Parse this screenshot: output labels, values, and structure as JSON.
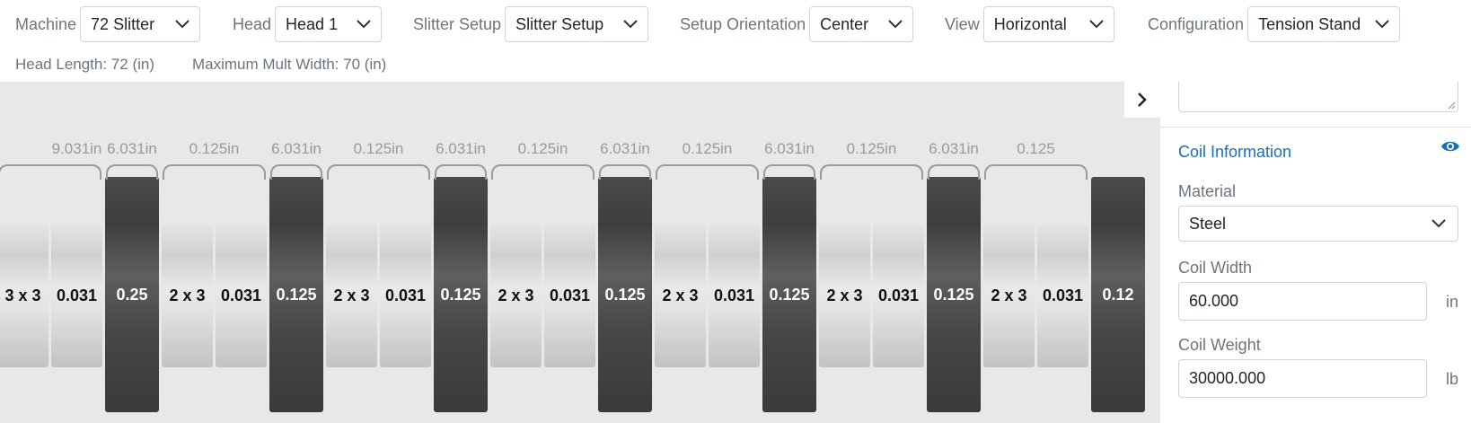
{
  "toolbar": {
    "machine": {
      "label": "Machine",
      "value": "72 Slitter"
    },
    "head": {
      "label": "Head",
      "value": "Head 1"
    },
    "slitter_setup": {
      "label": "Slitter Setup",
      "value": "Slitter Setup"
    },
    "setup_orientation": {
      "label": "Setup Orientation",
      "value": "Center"
    },
    "view": {
      "label": "View",
      "value": "Horizontal"
    },
    "configuration": {
      "label": "Configuration",
      "value": "Tension Stand"
    }
  },
  "info": {
    "head_length": "Head Length: 72 (in)",
    "max_mult_width": "Maximum Mult Width: 70 (in)"
  },
  "layout": {
    "dimension_labels": [
      "9.031in",
      "6.031in",
      "0.125in",
      "6.031in",
      "0.125in",
      "6.031in",
      "0.125in",
      "6.031in",
      "0.125in",
      "6.031in",
      "0.125in",
      "6.031in",
      "0.125"
    ],
    "tools": [
      {
        "type": "spacer",
        "label": "3 x 3"
      },
      {
        "type": "spacer",
        "label": "0.031"
      },
      {
        "type": "knife",
        "label": "0.25"
      },
      {
        "type": "spacer",
        "label": "2 x 3"
      },
      {
        "type": "spacer",
        "label": "0.031"
      },
      {
        "type": "knife",
        "label": "0.125"
      },
      {
        "type": "spacer",
        "label": "2 x 3"
      },
      {
        "type": "spacer",
        "label": "0.031"
      },
      {
        "type": "knife",
        "label": "0.125"
      },
      {
        "type": "spacer",
        "label": "2 x 3"
      },
      {
        "type": "spacer",
        "label": "0.031"
      },
      {
        "type": "knife",
        "label": "0.125"
      },
      {
        "type": "spacer",
        "label": "2 x 3"
      },
      {
        "type": "spacer",
        "label": "0.031"
      },
      {
        "type": "knife",
        "label": "0.125"
      },
      {
        "type": "spacer",
        "label": "2 x 3"
      },
      {
        "type": "spacer",
        "label": "0.031"
      },
      {
        "type": "knife",
        "label": "0.125"
      },
      {
        "type": "spacer",
        "label": "2 x 3"
      },
      {
        "type": "spacer",
        "label": "0.031"
      },
      {
        "type": "knife",
        "label": "0.12"
      }
    ]
  },
  "panel": {
    "toggle_icon": "chevron-right-icon",
    "section_title": "Coil Information",
    "visibility_icon": "eye-icon",
    "material": {
      "label": "Material",
      "value": "Steel"
    },
    "coil_width": {
      "label": "Coil Width",
      "value": "60.000",
      "unit": "in"
    },
    "coil_weight": {
      "label": "Coil Weight",
      "value": "30000.000",
      "unit": "lb"
    }
  },
  "colors": {
    "accent": "#1a6fb5",
    "knife": "#4a4a4a",
    "spacer": "#d9d9d9",
    "canvas": "#e8e8e9"
  }
}
